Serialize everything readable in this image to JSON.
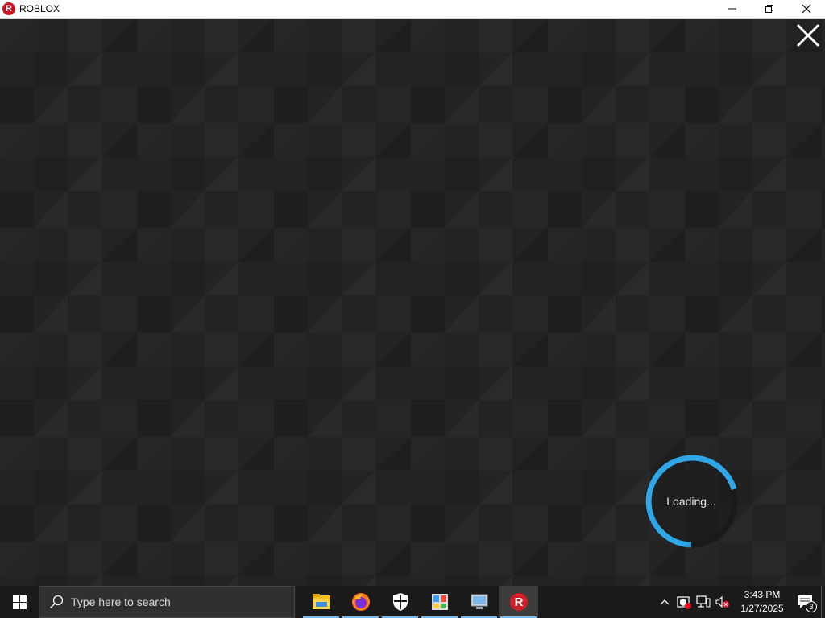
{
  "window": {
    "title": "ROBLOX",
    "icon": "roblox-logo-icon",
    "controls": [
      "minimize-icon",
      "restore-icon",
      "close-icon"
    ]
  },
  "game": {
    "loading_text": "Loading...",
    "close_icon": "close-x-icon",
    "spinner_color": "#2fa6e6"
  },
  "taskbar": {
    "search_placeholder": "Type here to search",
    "apps": [
      {
        "name": "file-explorer-icon",
        "running": true
      },
      {
        "name": "firefox-icon",
        "running": true
      },
      {
        "name": "windows-security-icon",
        "running": true
      },
      {
        "name": "control-panel-icon",
        "running": true
      },
      {
        "name": "remote-desktop-icon",
        "running": true
      },
      {
        "name": "roblox-icon",
        "running": true,
        "active": true
      }
    ],
    "tray": {
      "time": "3:43 PM",
      "date": "1/27/2025",
      "notification_count": "3",
      "icons": [
        "chevron-up-icon",
        "security-warning-icon",
        "network-icon",
        "volume-muted-icon"
      ]
    }
  }
}
